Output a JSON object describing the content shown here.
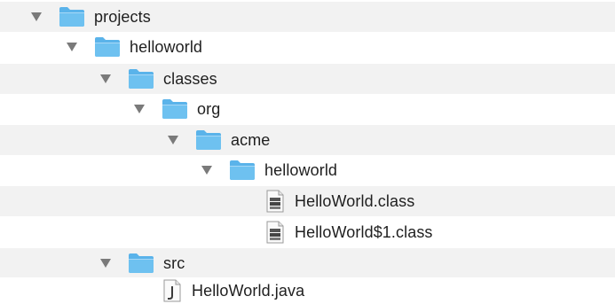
{
  "tree": {
    "items": [
      {
        "label": "projects",
        "type": "folder",
        "expanded": true,
        "depth": 0
      },
      {
        "label": "helloworld",
        "type": "folder",
        "expanded": true,
        "depth": 1
      },
      {
        "label": "classes",
        "type": "folder",
        "expanded": true,
        "depth": 2
      },
      {
        "label": "org",
        "type": "folder",
        "expanded": true,
        "depth": 3
      },
      {
        "label": "acme",
        "type": "folder",
        "expanded": true,
        "depth": 4
      },
      {
        "label": "helloworld",
        "type": "folder",
        "expanded": true,
        "depth": 5
      },
      {
        "label": "HelloWorld.class",
        "type": "class-file",
        "depth": 6
      },
      {
        "label": "HelloWorld$1.class",
        "type": "class-file",
        "depth": 6
      },
      {
        "label": "src",
        "type": "folder",
        "expanded": true,
        "depth": 2
      },
      {
        "label": "HelloWorld.java",
        "type": "java-file",
        "depth": 3
      }
    ]
  },
  "colors": {
    "row_alt": "#f2f2f2",
    "row_base": "#ffffff",
    "folder_blue": "#5ab3ea",
    "folder_light": "#a7d8f7",
    "triangle": "#7a7a7a"
  },
  "icons": {
    "folder": "folder-icon",
    "class-file": "class-file-icon",
    "java-file": "java-file-icon",
    "disclosure": "disclosure-triangle-down-icon"
  }
}
